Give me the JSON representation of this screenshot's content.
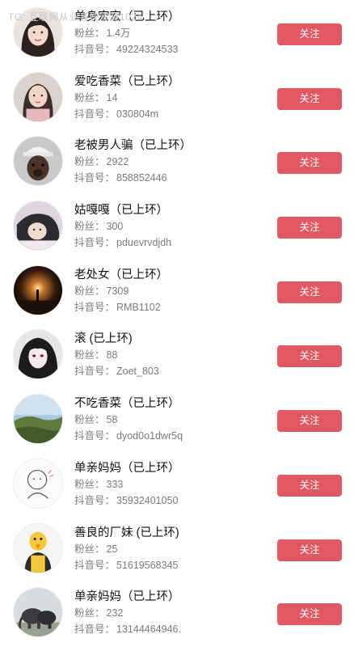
{
  "watermark": "TG: 互联网从业者快资源1024",
  "labels": {
    "fans": "粉丝：",
    "douyin_id": "抖音号："
  },
  "colors": {
    "follow_button": "#e25862"
  },
  "users": [
    {
      "name": "单身宏宏（已上环）",
      "fans": "1.4万",
      "douyin_id": "49224324533",
      "follow": "关注",
      "avatar": "woman-portrait"
    },
    {
      "name": "爱吃香菜（已上环）",
      "fans": "14",
      "douyin_id": "030804m",
      "follow": "关注",
      "avatar": "woman-portrait"
    },
    {
      "name": "老被男人骗（已上环）",
      "fans": "2922",
      "douyin_id": "858852446",
      "follow": "关注",
      "avatar": "dog-in-hat"
    },
    {
      "name": "姑嘎嘎（已上环）",
      "fans": "300",
      "douyin_id": "pduevrvdjdh",
      "follow": "关注",
      "avatar": "girl-lying"
    },
    {
      "name": "老处女（已上环）",
      "fans": "7309",
      "douyin_id": "RMB1102",
      "follow": "关注",
      "avatar": "night-light"
    },
    {
      "name": "滚 (已上环)",
      "fans": "88",
      "douyin_id": "Zoet_803",
      "follow": "关注",
      "avatar": "anime-girl"
    },
    {
      "name": "不吃香菜（已上环）",
      "fans": "58",
      "douyin_id": "dyod0o1dwr5q",
      "follow": "关注",
      "avatar": "landscape"
    },
    {
      "name": "单亲妈妈（已上环）",
      "fans": "333",
      "douyin_id": "35932401050",
      "follow": "关注",
      "avatar": "cartoon-sketch"
    },
    {
      "name": "善良的厂妹 (已上环)",
      "fans": "25",
      "douyin_id": "51619568345",
      "follow": "关注",
      "avatar": "duck-cartoon"
    },
    {
      "name": "单亲妈妈（已上环）",
      "fans": "232",
      "douyin_id": "13144464946.",
      "follow": "关注",
      "avatar": "elephants"
    }
  ]
}
